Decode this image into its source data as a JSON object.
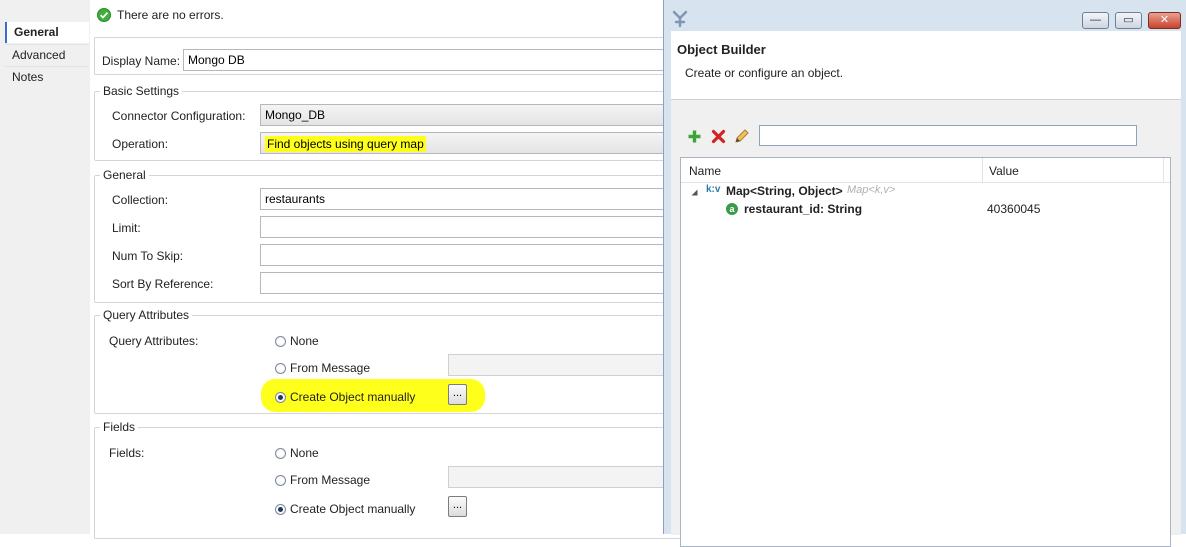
{
  "tabs": [
    {
      "label": "General",
      "active": true
    },
    {
      "label": "Advanced",
      "active": false
    },
    {
      "label": "Notes",
      "active": false
    }
  ],
  "status": {
    "message": "There are no errors.",
    "icon": "check-circle-icon"
  },
  "form": {
    "display_name_label": "Display Name:",
    "display_name_value": "Mongo DB",
    "basic_settings": {
      "legend": "Basic Settings",
      "connector_label": "Connector Configuration:",
      "connector_value": "Mongo_DB",
      "operation_label": "Operation:",
      "operation_value": "Find objects using query map"
    },
    "general": {
      "legend": "General",
      "collection_label": "Collection:",
      "collection_value": "restaurants",
      "limit_label": "Limit:",
      "limit_value": "",
      "skip_label": "Num To Skip:",
      "skip_value": "",
      "sort_label": "Sort By Reference:",
      "sort_value": ""
    },
    "query_attributes": {
      "legend": "Query Attributes",
      "label": "Query Attributes:",
      "options": [
        "None",
        "From Message",
        "Create Object manually"
      ],
      "selected": "Create Object manually",
      "browse_label": "..."
    },
    "fields": {
      "legend": "Fields",
      "label": "Fields:",
      "options": [
        "None",
        "From Message",
        "Create Object manually"
      ],
      "selected": "Create Object manually",
      "browse_label": "..."
    }
  },
  "dialog": {
    "window_buttons": {
      "minimize": "—",
      "maximize": "▭",
      "close": "✕"
    },
    "title": "Object Builder",
    "subtitle": "Create or configure an object.",
    "toolbar": {
      "add_icon": "plus-icon",
      "remove_icon": "red-x-icon",
      "edit_icon": "pencil-icon"
    },
    "search_value": "",
    "columns": [
      "Name",
      "Value"
    ],
    "tree": {
      "root": {
        "badge": "k:v",
        "label": "Map<String, Object>",
        "hint": "Map<k,v>"
      },
      "children": [
        {
          "badge": "a",
          "label": "restaurant_id: String",
          "value": "40360045"
        }
      ]
    }
  },
  "colors": {
    "highlight": "#ffff1c",
    "accent": "#3c6ec8",
    "dialog_frame": "#d8e3f0"
  }
}
